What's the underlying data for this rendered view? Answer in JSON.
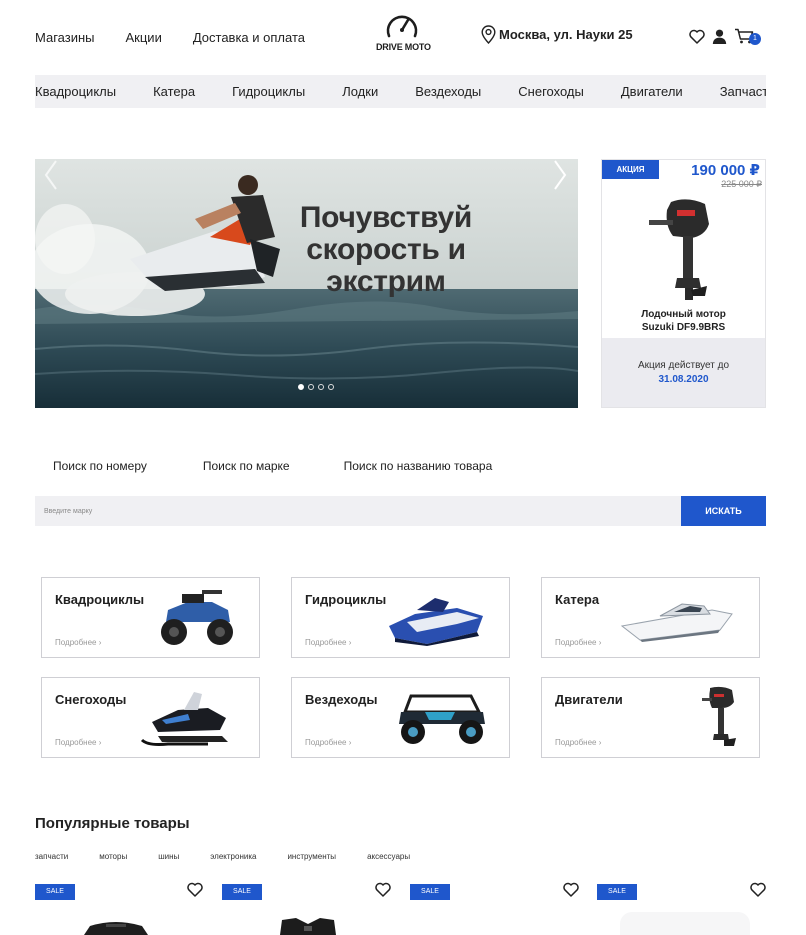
{
  "header": {
    "nav": [
      "Магазины",
      "Акции",
      "Доставка и оплата"
    ],
    "logo_text": "DRIVE MOTO",
    "address": "Москва, ул. Науки 25",
    "cart_count": "1"
  },
  "categories_bar": [
    "Квадроциклы",
    "Катера",
    "Гидроциклы",
    "Лодки",
    "Вездеходы",
    "Снегоходы",
    "Двигатели",
    "Запчасти"
  ],
  "hero": {
    "title_line1": "Почувствуй",
    "title_line2": "скорость и",
    "title_line3": "экстрим",
    "slides_count": 4,
    "active_slide": 1
  },
  "promo": {
    "tag": "АКЦИЯ",
    "price": "190 000 ₽",
    "old_price": "225 000 ₽",
    "name_line1": "Лодочный мотор",
    "name_line2": "Suzuki DF9.9BRS",
    "valid_label": "Акция действует до",
    "valid_date": "31.08.2020"
  },
  "search": {
    "tabs": [
      "Поиск по номеру",
      "Поиск по марке",
      "Поиск по названию товара"
    ],
    "placeholder": "Введите марку",
    "button": "ИСКАТЬ"
  },
  "category_cards": [
    {
      "title": "Квадроциклы",
      "more": "Подробнее ›",
      "icon": "atv"
    },
    {
      "title": "Гидроциклы",
      "more": "Подробнее ›",
      "icon": "jetski"
    },
    {
      "title": "Катера",
      "more": "Подробнее ›",
      "icon": "boat"
    },
    {
      "title": "Снегоходы",
      "more": "Подробнее ›",
      "icon": "snowmobile"
    },
    {
      "title": "Вездеходы",
      "more": "Подробнее ›",
      "icon": "buggy"
    },
    {
      "title": "Двигатели",
      "more": "Подробнее ›",
      "icon": "outboard-motor"
    }
  ],
  "popular": {
    "title": "Популярные товары",
    "tabs": [
      "запчасти",
      "моторы",
      "шины",
      "электроника",
      "инструменты",
      "аксессуары"
    ],
    "sale_label": "SALE"
  },
  "colors": {
    "accent": "#1f57cc",
    "bar_bg": "#f0f0f3"
  }
}
